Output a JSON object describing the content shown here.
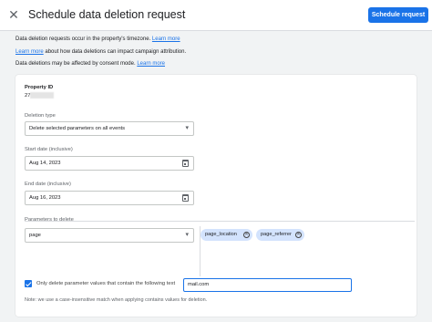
{
  "header": {
    "title": "Schedule data deletion request",
    "schedule_label": "Schedule request"
  },
  "info": {
    "line1_text": "Data deletion requests occur in the property's timezone.",
    "line1_link": "Learn more",
    "line2_link": "Learn more",
    "line2_text": "about how data deletions can impact campaign attribution.",
    "line3_text": "Data deletions may be affected by consent mode.",
    "line3_link": "Learn more"
  },
  "form": {
    "property_id_label": "Property ID",
    "property_id_value": "27",
    "deletion_type_label": "Deletion type",
    "deletion_type_value": "Delete selected parameters on all events",
    "start_date_label": "Start date (inclusive)",
    "start_date_value": "Aug 14, 2023",
    "end_date_label": "End date (inclusive)",
    "end_date_value": "Aug 16, 2023",
    "parameters_label": "Parameters to delete",
    "parameter_select_value": "page",
    "chips": [
      "page_location",
      "page_referrer"
    ],
    "only_delete_label": "Only delete parameter values that contain the following text",
    "only_delete_checked": true,
    "contains_text_value": "mail.com",
    "note": "Note: we use a case-insensitive match when applying contains values for deletion."
  },
  "icons": {
    "close": "close-icon",
    "dropdown": "chevron-down-icon",
    "calendar": "calendar-icon",
    "chip_remove": "cancel-circle-icon"
  },
  "colors": {
    "accent": "#1a73e8",
    "chip": "#d3e3fd",
    "background": "#f1f3f4"
  }
}
